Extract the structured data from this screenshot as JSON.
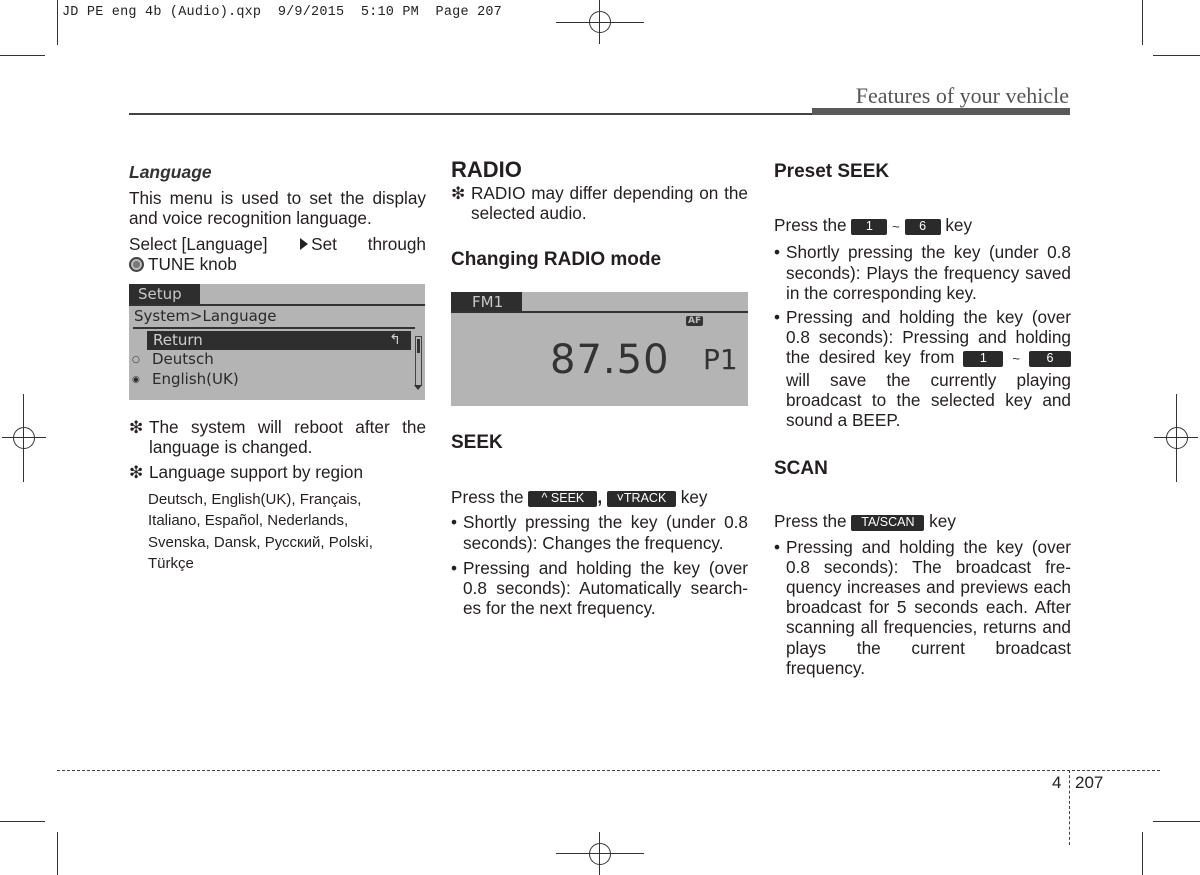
{
  "slug": "JD PE eng 4b (Audio).qxp  9/9/2015  5:10 PM  Page 207",
  "running_head": "Features of your vehicle",
  "footer": {
    "chapter": "4",
    "page": "207"
  },
  "col1": {
    "heading": "Language",
    "intro": "This menu is used to set the display and voice recognition language.",
    "select_pre": "Select [Language]",
    "select_post": "Set through",
    "knob_label": "TUNE knob",
    "screen": {
      "tab": "Setup",
      "breadcrumb": "System>Language",
      "selected_item": "Return",
      "return_icon": "↰",
      "options": [
        {
          "label": "Deutsch",
          "selected": false,
          "radio": "○"
        },
        {
          "label": "English(UK)",
          "selected": true,
          "radio": "◉"
        }
      ]
    },
    "note_mark": "❇",
    "note1": "The system will reboot after the language is changed.",
    "note2": "Language support by region",
    "languages": [
      "Deutsch, English(UK), Français,",
      "Italiano, Español, Nederlands,",
      "Svenska, Dansk, Русский, Polski,",
      "Türkçe"
    ]
  },
  "col2": {
    "heading": "RADIO",
    "note": "RADIO may differ depending on the selected audio.",
    "subheading": "Changing RADIO mode",
    "screen": {
      "band": "FM1",
      "af_badge": "AF",
      "frequency": "87.50",
      "preset": "P1"
    },
    "seek_heading": "SEEK",
    "press_the": "Press the",
    "seek_key": "SEEK",
    "seek_key_icon": "^",
    "comma": ",",
    "track_key": "TRACK",
    "track_key_icon": "˅",
    "key_word": "key",
    "bullets": [
      "Shortly pressing the key (under 0.8 seconds): Changes the frequency.",
      "Pressing and holding the key (over 0.8 seconds): Automatically search-es for the next frequency."
    ]
  },
  "col3": {
    "preset_heading": "Preset SEEK",
    "press_the": "Press the",
    "key_from": "1",
    "tilde": "~",
    "key_to": "6",
    "key_word": "key",
    "bullet1": "Shortly pressing the key (under 0.8 seconds): Plays the frequency saved in the corresponding key.",
    "bullet2_pre": "Pressing and holding the key (over 0.8 seconds): Pressing and holding the desired key from",
    "bullet2_post": "will save the currently playing broadcast to the selected key and sound a BEEP.",
    "scan_heading": "SCAN",
    "scan_key": "TA/SCAN",
    "scan_bullet": "Pressing and holding the key (over 0.8 seconds): The broadcast fre-quency increases and previews each broadcast for 5 seconds each. After scanning all frequencies, returns and plays the current broadcast frequency."
  },
  "bullet_char": "•"
}
